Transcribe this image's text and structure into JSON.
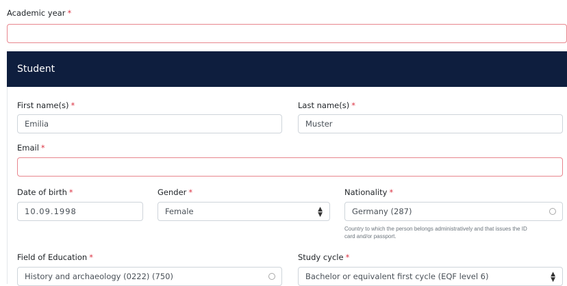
{
  "academic_year": {
    "label": "Academic year",
    "required_mark": "*",
    "value": ""
  },
  "student_card": {
    "title": "Student",
    "first_name": {
      "label": "First name(s)",
      "required_mark": "*",
      "value": "Emilia"
    },
    "last_name": {
      "label": "Last name(s)",
      "required_mark": "*",
      "value": "Muster"
    },
    "email": {
      "label": "Email",
      "required_mark": "*",
      "value": ""
    },
    "date_of_birth": {
      "label": "Date of birth",
      "required_mark": "*",
      "value": "10.09.1998"
    },
    "gender": {
      "label": "Gender",
      "required_mark": "*",
      "value": "Female",
      "icon": "select-arrows-icon"
    },
    "nationality": {
      "label": "Nationality",
      "required_mark": "*",
      "value": "Germany (287)",
      "icon": "clear-circle-icon",
      "help_line1": "Country to which the person belongs administratively and that issues the ID",
      "help_line2": "card and/or passport."
    },
    "field_of_education": {
      "label": "Field of Education",
      "required_mark": "*",
      "value": "History and archaeology (0222) (750)",
      "icon": "clear-circle-icon"
    },
    "study_cycle": {
      "label": "Study cycle",
      "required_mark": "*",
      "value": "Bachelor or equivalent first cycle (EQF level 6)",
      "icon": "select-arrows-icon"
    }
  },
  "colors": {
    "header_bg": "#0e1e3e",
    "required": "#dc3545",
    "invalid_border": "#e8858d",
    "input_border": "#ced4da"
  }
}
